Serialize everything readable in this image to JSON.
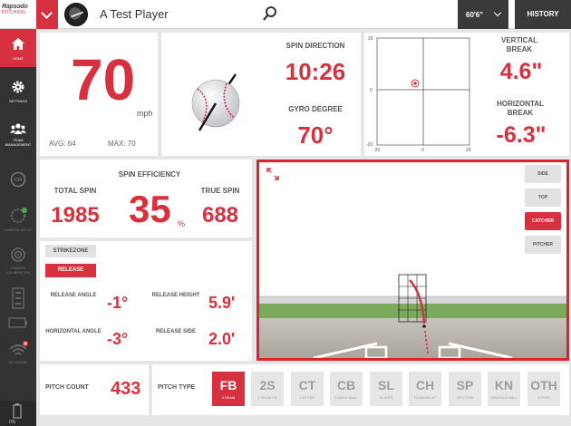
{
  "brand": {
    "name": "Rapsodo",
    "product": "PITCHING"
  },
  "header": {
    "player_name": "A Test Player",
    "distance": "60'6\"",
    "history_label": "HISTORY"
  },
  "sidebar": {
    "items": [
      {
        "label": "HOME",
        "icon": "home-icon"
      },
      {
        "label": "SETTINGS",
        "icon": "gear-icon"
      },
      {
        "label": "TEAM MANAGEMENT",
        "icon": "team-icon"
      },
      {
        "label": "",
        "icon": "camera-icon"
      },
      {
        "label": "CAMERA SETUP",
        "icon": "calibration-icon"
      },
      {
        "label": "CAMERA CALIBRATION",
        "icon": "target-icon"
      },
      {
        "label": "",
        "icon": "sensor-icon"
      },
      {
        "label": "",
        "icon": "device-icon"
      },
      {
        "label": "NO SIGNAL",
        "icon": "wifi-icon"
      }
    ],
    "battery": "0%"
  },
  "speed": {
    "value": "70",
    "unit": "mph",
    "avg_label": "AVG:",
    "avg": "64",
    "max_label": "MAX:",
    "max": "70"
  },
  "spin_direction": {
    "label": "SPIN DIRECTION",
    "value": "10:26"
  },
  "gyro": {
    "label": "GYRO DEGREE",
    "value": "70°"
  },
  "break_plot": {
    "y_top": "20",
    "y_mid": "0",
    "y_bottom": "-20",
    "x_left": "-20",
    "x_mid": "0",
    "x_right": "20"
  },
  "vertical_break": {
    "label": "VERTICAL BREAK",
    "value": "4.6\""
  },
  "horizontal_break": {
    "label": "HORIZONTAL BREAK",
    "value": "-6.3\""
  },
  "spin": {
    "efficiency_label": "SPIN EFFICIENCY",
    "efficiency": "35",
    "efficiency_unit": "%",
    "total_label": "TOTAL SPIN",
    "total": "1985",
    "true_label": "TRUE SPIN",
    "true": "688"
  },
  "release": {
    "tabs": [
      "STRIKEZONE",
      "RELEASE"
    ],
    "angle_label": "RELEASE ANGLE",
    "angle": "-1°",
    "height_label": "RELEASE HEIGHT",
    "height": "5.9'",
    "h_angle_label": "HORIZONTAL ANGLE",
    "h_angle": "-3°",
    "side_label": "RELEASE SIDE",
    "side": "2.0'"
  },
  "view_buttons": [
    "SIDE",
    "TOP",
    "CATCHER",
    "PITCHER"
  ],
  "pitch_count": {
    "label": "PITCH COUNT",
    "value": "433"
  },
  "pitch_type": {
    "label": "PITCH TYPE",
    "options": [
      {
        "abbr": "FB",
        "name": "4 SEAM"
      },
      {
        "abbr": "2S",
        "name": "2 SEAM FB"
      },
      {
        "abbr": "CT",
        "name": "CUTTER"
      },
      {
        "abbr": "CB",
        "name": "CURVE BALL"
      },
      {
        "abbr": "SL",
        "name": "SLIDER"
      },
      {
        "abbr": "CH",
        "name": "CHANGE UP"
      },
      {
        "abbr": "SP",
        "name": "SPLITTER"
      },
      {
        "abbr": "KN",
        "name": "KNUCKLE BALL"
      },
      {
        "abbr": "OTH",
        "name": "OTHER"
      }
    ],
    "selected": "FB"
  },
  "colors": {
    "accent": "#d7303e",
    "dark": "#333333",
    "bg": "#e6e6e6"
  }
}
